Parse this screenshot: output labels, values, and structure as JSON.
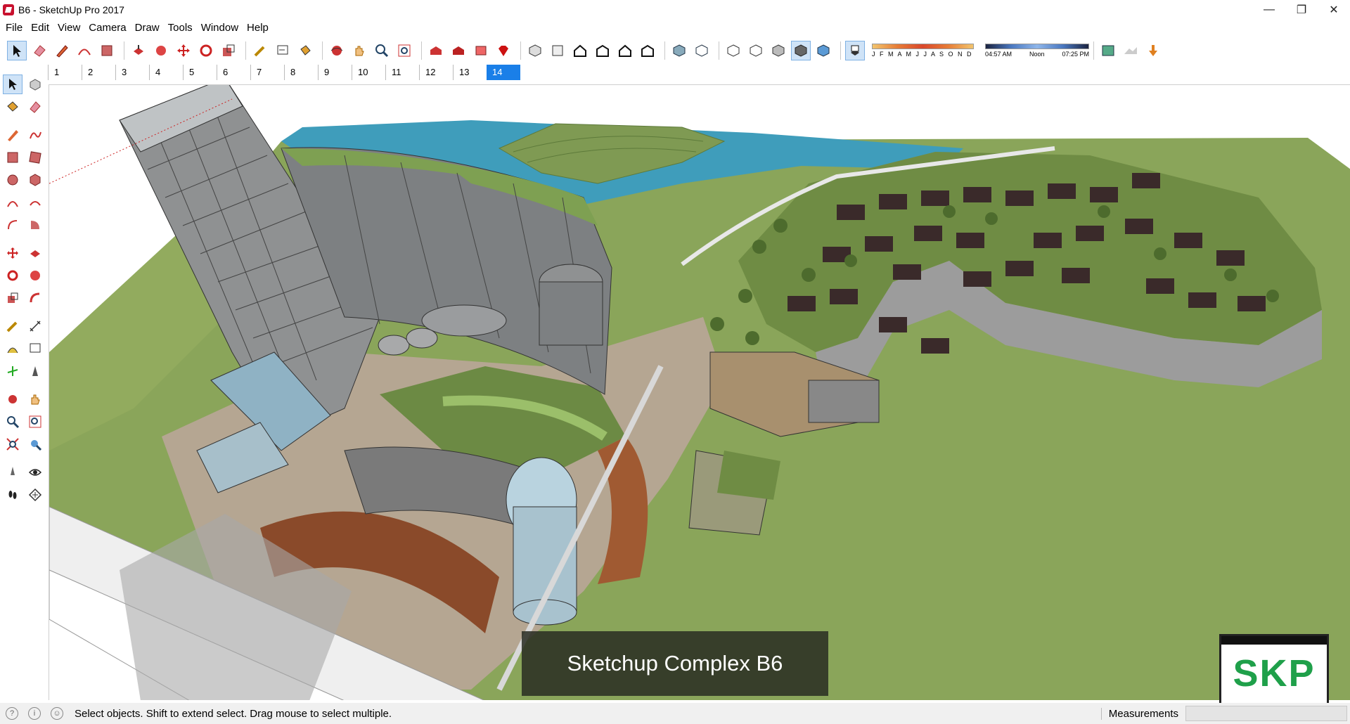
{
  "window": {
    "title": "B6 - SketchUp Pro 2017"
  },
  "menu": [
    "File",
    "Edit",
    "View",
    "Camera",
    "Draw",
    "Tools",
    "Window",
    "Help"
  ],
  "shadow": {
    "months": "J F M A M J J A S O N D",
    "time_start": "04:57 AM",
    "time_mid": "Noon",
    "time_end": "07:25 PM"
  },
  "scenes": [
    "1",
    "2",
    "3",
    "4",
    "5",
    "6",
    "7",
    "8",
    "9",
    "10",
    "11",
    "12",
    "13",
    "14"
  ],
  "active_scene": "14",
  "caption": "Sketchup Complex B6",
  "badge": "SKP",
  "status": {
    "message": "Select objects. Shift to extend select. Drag mouse to select multiple.",
    "measurements_label": "Measurements",
    "measurements_value": ""
  },
  "colors": {
    "grass": "#8aa55a",
    "water": "#3f9dbb",
    "scene_active": "#1a7fe8",
    "badge_text": "#1fa04a"
  }
}
